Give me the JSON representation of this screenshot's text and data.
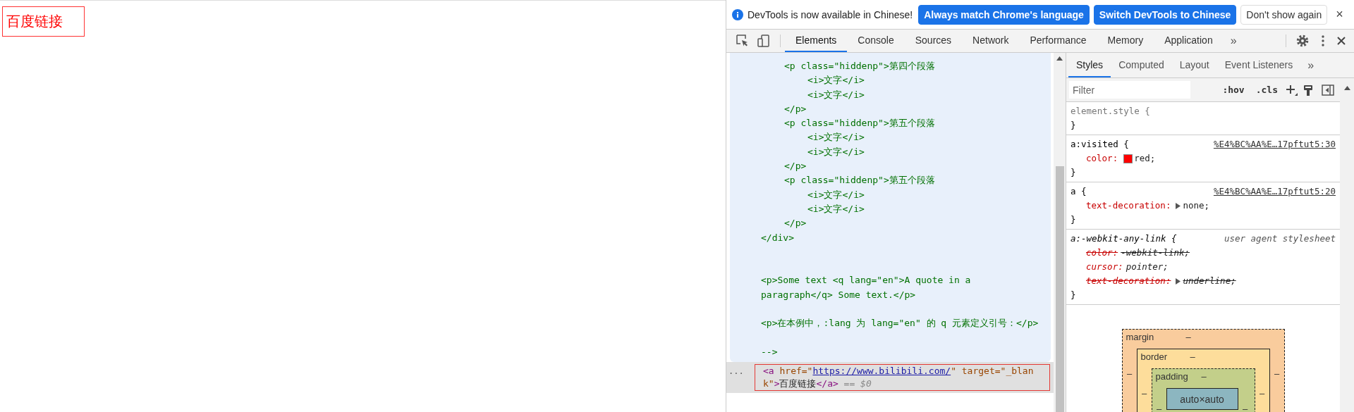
{
  "page": {
    "link": "百度链接"
  },
  "devtools": {
    "infobar": {
      "message": "DevTools is now available in Chinese!",
      "buttons": [
        {
          "label": "Always match Chrome's language",
          "kind": "primary"
        },
        {
          "label": "Switch DevTools to Chinese",
          "kind": "primary"
        },
        {
          "label": "Don't show again",
          "kind": "secondary"
        }
      ],
      "close": "×"
    },
    "tabs": [
      {
        "label": "Elements",
        "selected": true
      },
      {
        "label": "Console",
        "selected": false
      },
      {
        "label": "Sources",
        "selected": false
      },
      {
        "label": "Network",
        "selected": false
      },
      {
        "label": "Performance",
        "selected": false
      },
      {
        "label": "Memory",
        "selected": false
      },
      {
        "label": "Application",
        "selected": false
      }
    ],
    "more_tabs": "»",
    "elements": {
      "comment_lines": [
        {
          "kind": "group",
          "children": [
            {
              "kind": "code",
              "text": "<p class=\"hiddenp\">第四个段落",
              "children": [
                {
                  "kind": "code",
                  "text": "<i>文字</i>"
                },
                {
                  "kind": "code",
                  "text": "<i>文字</i>"
                }
              ]
            },
            {
              "kind": "code",
              "text": "</p>"
            },
            {
              "kind": "code",
              "text": "<p class=\"hiddenp\">第五个段落",
              "children": [
                {
                  "kind": "code",
                  "text": "<i>文字</i>"
                },
                {
                  "kind": "code",
                  "text": "<i>文字</i>"
                }
              ]
            },
            {
              "kind": "code",
              "text": "</p>"
            },
            {
              "kind": "code",
              "text": "<p class=\"hiddenp\">第五个段落",
              "children": [
                {
                  "kind": "code",
                  "text": "<i>文字</i>"
                },
                {
                  "kind": "code",
                  "text": "<i>文字</i>"
                }
              ]
            },
            {
              "kind": "code",
              "text": "</p>"
            }
          ]
        },
        {
          "kind": "code",
          "text": "</div>"
        },
        {
          "kind": "blank"
        },
        {
          "kind": "blank"
        },
        {
          "kind": "code",
          "text": "<p>Some text <q lang=\"en\">A quote in a paragraph</q> Some text.</p>"
        },
        {
          "kind": "blank"
        },
        {
          "kind": "code",
          "text": "<p>在本例中，:lang 为 lang=\"en\" 的 q 元素定义引号：</p>"
        },
        {
          "kind": "blank"
        },
        {
          "kind": "code",
          "text": "-->"
        }
      ],
      "selected_line": {
        "marker": "...",
        "segments": [
          {
            "kind": "tag",
            "text": "<a"
          },
          {
            "kind": "attr",
            "text": " href=\""
          },
          {
            "kind": "link",
            "text": "https://www.bilibili.com/"
          },
          {
            "kind": "attr",
            "text": "\" target=\"_blank\""
          },
          {
            "kind": "tag",
            "text": ">"
          },
          {
            "kind": "text",
            "text": "百度链接"
          },
          {
            "kind": "tag",
            "text": "</a>"
          },
          {
            "kind": "hint",
            "text": " == $0"
          }
        ]
      }
    },
    "styles": {
      "tabs": [
        {
          "label": "Styles",
          "selected": true
        },
        {
          "label": "Computed",
          "selected": false
        },
        {
          "label": "Layout",
          "selected": false
        },
        {
          "label": "Event Listeners",
          "selected": false
        }
      ],
      "more_tabs": "»",
      "filter": {
        "placeholder": "Filter"
      },
      "hov": ":hov",
      "cls": ".cls",
      "rules": [
        {
          "kind": "inline",
          "selector": "element.style {",
          "close": "}"
        },
        {
          "kind": "author",
          "selector": "a:visited {",
          "source": "%E4%BC%AA%E…17pftut5:30",
          "close": "}",
          "properties": [
            {
              "name": "color:",
              "value": "red;",
              "color": "#ff0000",
              "expandable": false,
              "overridden": false
            }
          ]
        },
        {
          "kind": "author",
          "selector": "a {",
          "source": "%E4%BC%AA%E…17pftut5:20",
          "close": "}",
          "properties": [
            {
              "name": "text-decoration:",
              "value": "none;",
              "expandable": true,
              "overridden": false
            }
          ]
        },
        {
          "kind": "user_agent",
          "selector": "a:-webkit-any-link {",
          "source": "user agent stylesheet",
          "close": "}",
          "properties": [
            {
              "name": "color:",
              "value": "-webkit-link;",
              "expandable": false,
              "overridden": true
            },
            {
              "name": "cursor:",
              "value": "pointer;",
              "expandable": false,
              "overridden": false
            },
            {
              "name": "text-decoration:",
              "value": "underline;",
              "expandable": true,
              "overridden": true
            }
          ]
        }
      ],
      "box_model": {
        "margin": {
          "label": "margin",
          "top": "–",
          "left": "–",
          "right": "–"
        },
        "border": {
          "label": "border",
          "top": "–",
          "left": "–",
          "right": "–"
        },
        "padding": {
          "label": "padding",
          "top": "–",
          "left": "–",
          "right": "–"
        },
        "content": "auto×auto"
      }
    }
  }
}
